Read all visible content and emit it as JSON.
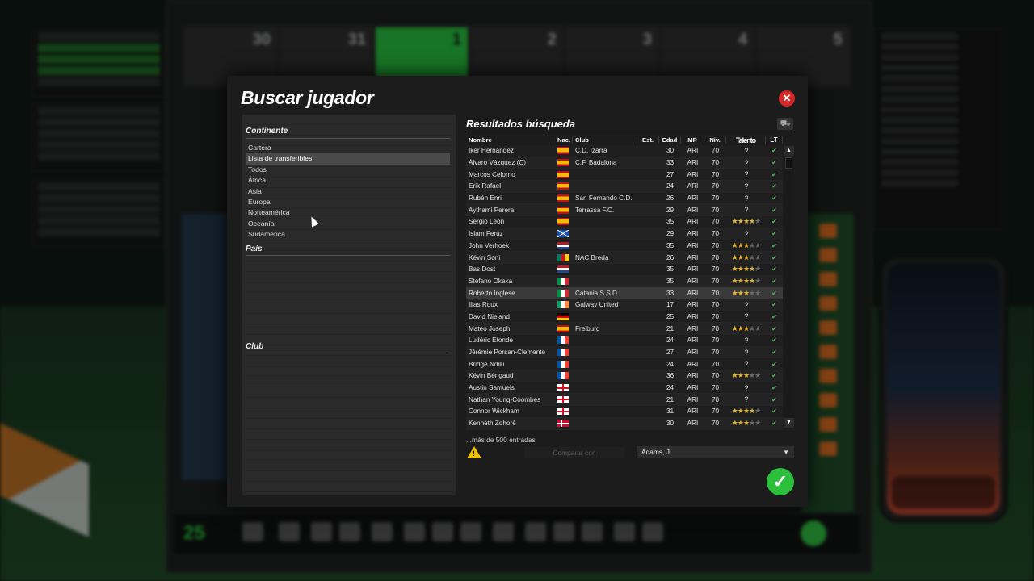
{
  "modal": {
    "title": "Buscar jugador",
    "close_icon": "close-icon"
  },
  "filters": {
    "continent_title": "Continente",
    "continent_options": [
      "Cartera",
      "Lista de transferibles",
      "Todos",
      "África",
      "Asia",
      "Europa",
      "Norteamérica",
      "Oceanía",
      "Sudamérica"
    ],
    "selected_continent": "Lista de transferibles",
    "country_title": "País",
    "club_title": "Club"
  },
  "results": {
    "title": "Resultados búsqueda",
    "headers": {
      "name": "Nombre",
      "nat": "Nac.",
      "club": "Club",
      "est": "Est.",
      "age": "Edad",
      "mp": "MP",
      "niv": "Niv.",
      "talent": "Talento",
      "lt": "LT"
    },
    "rows": [
      {
        "name": "Iker Hernández",
        "flag": "es",
        "club": "C.D. Izarra",
        "age": "30",
        "mp": "ARI",
        "niv": "70",
        "talent": "?"
      },
      {
        "name": "Álvaro Vázquez (C)",
        "flag": "es",
        "club": "C.F. Badalona",
        "age": "33",
        "mp": "ARI",
        "niv": "70",
        "talent": "?"
      },
      {
        "name": "Marcos Celorrio",
        "flag": "es",
        "club": "",
        "age": "27",
        "mp": "ARI",
        "niv": "70",
        "talent": "?"
      },
      {
        "name": "Erik Rafael",
        "flag": "es",
        "club": "",
        "age": "24",
        "mp": "ARI",
        "niv": "70",
        "talent": "?"
      },
      {
        "name": "Rubén Enri",
        "flag": "es",
        "club": "San Fernando C.D.",
        "age": "26",
        "mp": "ARI",
        "niv": "70",
        "talent": "?"
      },
      {
        "name": "Aythami Perera",
        "flag": "es",
        "club": "Terrassa F.C.",
        "age": "29",
        "mp": "ARI",
        "niv": "70",
        "talent": "?"
      },
      {
        "name": "Sergio León",
        "flag": "es",
        "club": "",
        "age": "35",
        "mp": "ARI",
        "niv": "70",
        "talent": "★★★½★"
      },
      {
        "name": "Islam Feruz",
        "flag": "sc",
        "club": "",
        "age": "29",
        "mp": "ARI",
        "niv": "70",
        "talent": "?"
      },
      {
        "name": "John Verhoek",
        "flag": "nl",
        "club": "",
        "age": "35",
        "mp": "ARI",
        "niv": "70",
        "talent": "★★½★★"
      },
      {
        "name": "Kévin Soni",
        "flag": "cm",
        "club": "NAC Breda",
        "age": "26",
        "mp": "ARI",
        "niv": "70",
        "talent": "★★½★★"
      },
      {
        "name": "Bas Dost",
        "flag": "nl",
        "club": "",
        "age": "35",
        "mp": "ARI",
        "niv": "70",
        "talent": "★★★½★"
      },
      {
        "name": "Stefano Okaka",
        "flag": "it",
        "club": "",
        "age": "35",
        "mp": "ARI",
        "niv": "70",
        "talent": "★★★½★"
      },
      {
        "name": "Roberto Inglese",
        "flag": "it",
        "club": "Catania S.S.D.",
        "age": "33",
        "mp": "ARI",
        "niv": "70",
        "talent": "★★★★★"
      },
      {
        "name": "Ilias Roux",
        "flag": "ie",
        "club": "Galway United",
        "age": "17",
        "mp": "ARI",
        "niv": "70",
        "talent": "?"
      },
      {
        "name": "David Nieland",
        "flag": "de",
        "club": "",
        "age": "25",
        "mp": "ARI",
        "niv": "70",
        "talent": "?"
      },
      {
        "name": "Mateo Joseph",
        "flag": "es",
        "club": "Freiburg",
        "age": "21",
        "mp": "ARI",
        "niv": "70",
        "talent": "★★★★★"
      },
      {
        "name": "Ludéric Etonde",
        "flag": "fr",
        "club": "",
        "age": "24",
        "mp": "ARI",
        "niv": "70",
        "talent": "?"
      },
      {
        "name": "Jérémie Porsan-Clemente",
        "flag": "fr",
        "club": "",
        "age": "27",
        "mp": "ARI",
        "niv": "70",
        "talent": "?"
      },
      {
        "name": "Bridge Ndilu",
        "flag": "fr",
        "club": "",
        "age": "24",
        "mp": "ARI",
        "niv": "70",
        "talent": "?"
      },
      {
        "name": "Kévin Bérigaud",
        "flag": "fr",
        "club": "",
        "age": "36",
        "mp": "ARI",
        "niv": "70",
        "talent": "★★★★★"
      },
      {
        "name": "Austin Samuels",
        "flag": "en",
        "club": "",
        "age": "24",
        "mp": "ARI",
        "niv": "70",
        "talent": "?"
      },
      {
        "name": "Nathan Young-Coombes",
        "flag": "en",
        "club": "",
        "age": "21",
        "mp": "ARI",
        "niv": "70",
        "talent": "?"
      },
      {
        "name": "Connor Wickham",
        "flag": "en",
        "club": "",
        "age": "31",
        "mp": "ARI",
        "niv": "70",
        "talent": "★★★½★"
      },
      {
        "name": "Kenneth Zohorè",
        "flag": "dk",
        "club": "",
        "age": "30",
        "mp": "ARI",
        "niv": "70",
        "talent": "★★★★★"
      }
    ],
    "talent_stars": [
      null,
      null,
      null,
      null,
      null,
      null,
      3.5,
      null,
      2.5,
      2.5,
      3.5,
      3.5,
      3,
      null,
      null,
      3,
      null,
      null,
      null,
      3,
      null,
      null,
      3.5,
      3
    ],
    "highlighted_row": 12,
    "more_text": "...más de 500 entradas",
    "compare_label": "Comparar con",
    "compare_select_value": "Adams, J",
    "ok_icon": "check-icon"
  },
  "background": {
    "calendar_days": [
      "30",
      "31",
      "1",
      "2",
      "3",
      "4",
      "5"
    ],
    "toolbar_number": "25"
  }
}
